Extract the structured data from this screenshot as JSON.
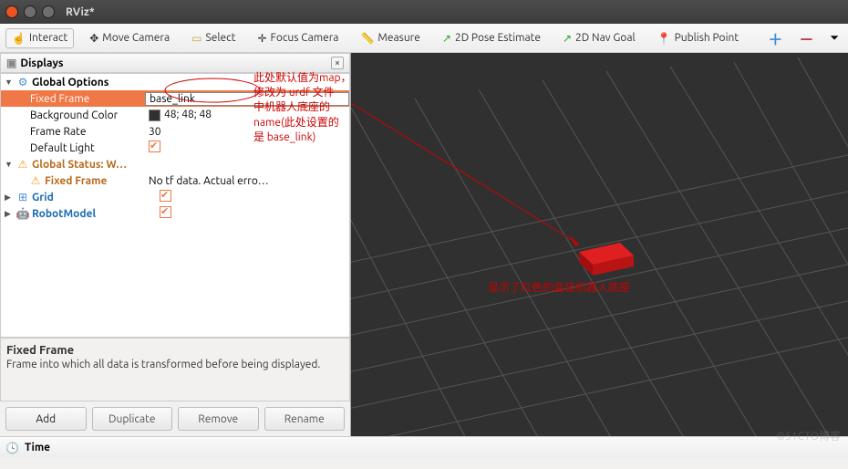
{
  "window": {
    "title": "RViz*"
  },
  "toolbar": {
    "interact": "Interact",
    "move_camera": "Move Camera",
    "select": "Select",
    "focus_camera": "Focus Camera",
    "measure": "Measure",
    "pose_estimate": "2D Pose Estimate",
    "nav_goal": "2D Nav Goal",
    "publish_point": "Publish Point"
  },
  "panel": {
    "displays_title": "Displays",
    "global_options": "Global Options",
    "fixed_frame_label": "Fixed Frame",
    "fixed_frame_value": "base_link",
    "bg_color_label": "Background Color",
    "bg_color_value": "48; 48; 48",
    "frame_rate_label": "Frame Rate",
    "frame_rate_value": "30",
    "default_light_label": "Default Light",
    "global_status_label": "Global Status: W…",
    "fixed_frame_status_label": "Fixed Frame",
    "fixed_frame_status_value": "No tf data.  Actual erro…",
    "grid_label": "Grid",
    "robotmodel_label": "RobotModel"
  },
  "description": {
    "title": "Fixed Frame",
    "body": "Frame into which all data is transformed before being displayed."
  },
  "buttons": {
    "add": "Add",
    "duplicate": "Duplicate",
    "remove": "Remove",
    "rename": "Rename"
  },
  "timebar": {
    "label": "Time"
  },
  "annotations": {
    "note1": "此处默认值为map，",
    "note2": "修改为 urdf 文件",
    "note3": "中机器人底座的",
    "note4": "name(此处设置的",
    "note5": "是 base_link)",
    "viewport_label": "显示了红色的盒装机器人底座"
  },
  "watermark": "©51CTO博客",
  "viewport": {
    "bg": "#303030",
    "grid_color": "#555",
    "box_color": "#d01818"
  }
}
